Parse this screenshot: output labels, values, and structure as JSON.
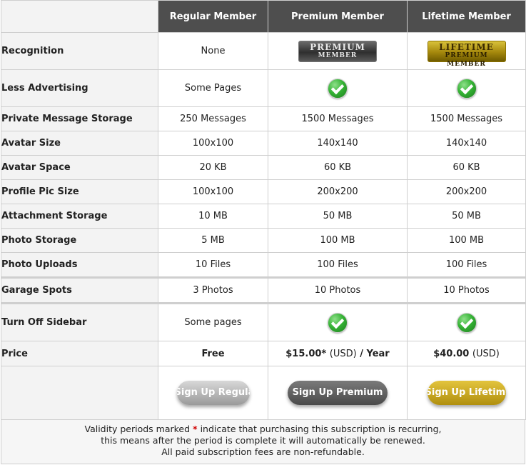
{
  "headers": [
    "Regular Member",
    "Premium Member",
    "Lifetime Member"
  ],
  "badges": {
    "premium": {
      "line1": "PREMIUM",
      "line2": "MEMBER"
    },
    "lifetime": {
      "line1": "LIFETIME",
      "line2": "PREMIUM MEMBER"
    }
  },
  "rows": {
    "recognition": {
      "label": "Recognition",
      "regular": "None"
    },
    "less_advertising": {
      "label": "Less Advertising",
      "regular": "Some Pages"
    },
    "pm_storage": {
      "label": "Private Message Storage",
      "regular": "250 Messages",
      "premium": "1500 Messages",
      "lifetime": "1500 Messages"
    },
    "avatar_size": {
      "label": "Avatar Size",
      "regular": "100x100",
      "premium": "140x140",
      "lifetime": "140x140"
    },
    "avatar_space": {
      "label": "Avatar Space",
      "regular": "20 KB",
      "premium": "60 KB",
      "lifetime": "60 KB"
    },
    "profile_pic": {
      "label": "Profile Pic Size",
      "regular": "100x100",
      "premium": "200x200",
      "lifetime": "200x200"
    },
    "attachment": {
      "label": "Attachment Storage",
      "regular": "10 MB",
      "premium": "50 MB",
      "lifetime": "50 MB"
    },
    "photo_storage": {
      "label": "Photo Storage",
      "regular": "5 MB",
      "premium": "100 MB",
      "lifetime": "100 MB"
    },
    "photo_uploads": {
      "label": "Photo Uploads",
      "regular": "10 Files",
      "premium": "100 Files",
      "lifetime": "100 Files"
    },
    "garage": {
      "label": "Garage Spots",
      "regular": "3 Photos",
      "premium": "10 Photos",
      "lifetime": "10 Photos"
    },
    "sidebar": {
      "label": "Turn Off Sidebar",
      "regular": "Some pages"
    },
    "price": {
      "label": "Price",
      "regular": "Free",
      "premium_amount": "$15.00*",
      "premium_currency": "(USD)",
      "premium_period": "/ Year",
      "lifetime_amount": "$40.00",
      "lifetime_currency": "(USD)"
    }
  },
  "buttons": {
    "regular": "Sign Up Regular",
    "premium": "Sign Up Premium",
    "lifetime": "Sign Up Lifetime"
  },
  "note": {
    "line1_a": "Validity periods marked",
    "star": "*",
    "line1_b": "indicate that purchasing this subscription is recurring,",
    "line2": "this means after the period is complete it will automatically be renewed.",
    "line3": "All paid subscription fees are non-refundable."
  },
  "colors": {
    "header_bg": "#4e4e4e",
    "check_green": "#35b335",
    "lifetime_gold": "#c9a824"
  }
}
